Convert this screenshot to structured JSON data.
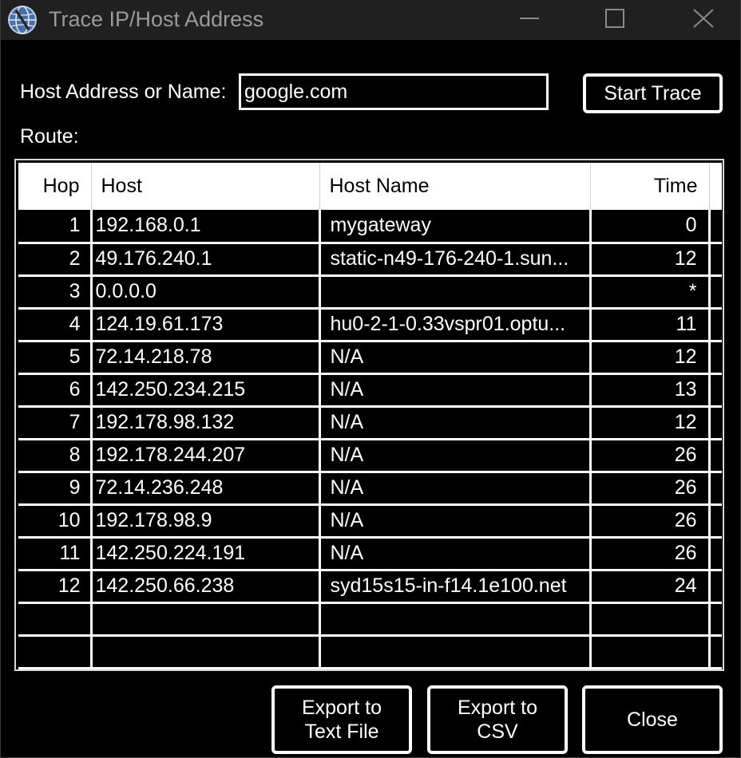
{
  "window": {
    "title": "Trace IP/Host Address",
    "icon": "network-globe-icon",
    "controls": [
      "minimize-icon",
      "maximize-icon",
      "close-icon"
    ]
  },
  "form": {
    "host_label": "Host Address or Name:",
    "host_value": "google.com",
    "start_button": "Start Trace",
    "route_label": "Route:"
  },
  "table": {
    "columns": [
      "Hop",
      "Host",
      "Host Name",
      "Time"
    ],
    "rows": [
      [
        "1",
        "192.168.0.1",
        "mygateway",
        "0"
      ],
      [
        "2",
        "49.176.240.1",
        "static-n49-176-240-1.sun...",
        "12"
      ],
      [
        "3",
        "0.0.0.0",
        "",
        "*"
      ],
      [
        "4",
        "124.19.61.173",
        "hu0-2-1-0.33vspr01.optu...",
        "11"
      ],
      [
        "5",
        "72.14.218.78",
        "N/A",
        "12"
      ],
      [
        "6",
        "142.250.234.215",
        "N/A",
        "13"
      ],
      [
        "7",
        "192.178.98.132",
        "N/A",
        "12"
      ],
      [
        "8",
        "192.178.244.207",
        "N/A",
        "26"
      ],
      [
        "9",
        "72.14.236.248",
        "N/A",
        "26"
      ],
      [
        "10",
        "192.178.98.9",
        "N/A",
        "26"
      ],
      [
        "11",
        "142.250.224.191",
        "N/A",
        "26"
      ],
      [
        "12",
        "142.250.66.238",
        "syd15s15-in-f14.1e100.net",
        "24"
      ]
    ]
  },
  "buttons": {
    "export_text": "Export to\nText File",
    "export_csv": "Export to\nCSV",
    "close": "Close"
  },
  "colors": {
    "background": "#000000",
    "titlebar": "#202020",
    "title_text": "#9a9a9a",
    "foreground": "#ffffff"
  }
}
